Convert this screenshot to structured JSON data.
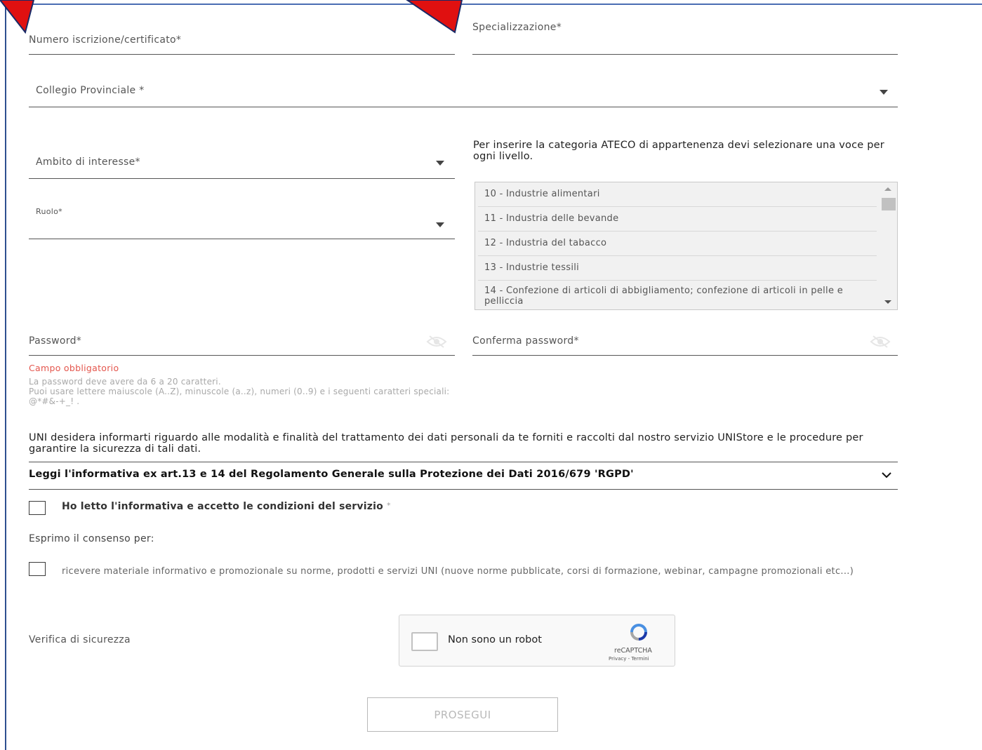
{
  "form": {
    "numero_label": "Numero iscrizione/certificato*",
    "specializzazione_label": "Specializzazione*",
    "collegio_label": "Collegio Provinciale *",
    "ambito_label": "Ambito di interesse*",
    "ruolo_label": "Ruolo*"
  },
  "ateco": {
    "hint": "Per inserire la categoria ATECO di appartenenza devi selezionare una voce per ogni livello.",
    "items": [
      "10 - Industrie alimentari",
      "11 - Industria delle bevande",
      "12 - Industria del tabacco",
      "13 - Industrie tessili",
      "14 - Confezione di articoli di abbigliamento; confezione di articoli in pelle e pelliccia"
    ]
  },
  "password": {
    "label": "Password*",
    "confirm_label": "Conferma password*",
    "error": "Campo obbligatorio",
    "hint_line1": "La password deve avere da 6 a 20 caratteri.",
    "hint_line2": "Puoi usare lettere maiuscole (A..Z), minuscole (a..z), numeri (0..9) e i seguenti caratteri speciali: @*#&-+_! ."
  },
  "privacy": {
    "text": "UNI desidera informarti riguardo alle modalità e finalità del trattamento dei dati personali da te forniti e raccolti dal nostro servizio UNIStore e le procedure per garantire la sicurezza di tali dati.",
    "accordion_title": "Leggi l'informativa ex art.13 e 14 del Regolamento Generale sulla Protezione dei Dati 2016/679 'RGPD'",
    "accept_label": "Ho letto l'informativa e accetto le condizioni del servizio",
    "accept_required": "*"
  },
  "consent": {
    "title": "Esprimo il consenso per:",
    "promo_label": "ricevere materiale informativo e promozionale su norme, prodotti e servizi UNI (nuove norme pubblicate, corsi di formazione, webinar, campagne promozionali etc...)"
  },
  "security": {
    "label": "Verifica di sicurezza",
    "captcha_text": "Non sono un robot",
    "captcha_brand": "reCAPTCHA",
    "captcha_links": "Privacy - Termini"
  },
  "submit_label": "PROSEGUI",
  "colors": {
    "error": "#e4564d",
    "frame": "#2e4f8f",
    "arrow": "#e01010"
  },
  "icons": [
    "chevron-down-icon",
    "caret-down-icon",
    "eye-slash-icon",
    "recaptcha-logo-icon",
    "arrow-pointer-icon"
  ]
}
